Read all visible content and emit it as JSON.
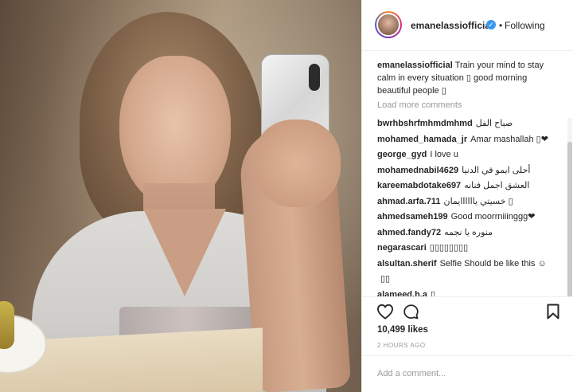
{
  "post": {
    "username": "emanelassiofficial",
    "follow_label": "Following",
    "caption_user": "emanelassiofficial",
    "caption_text": "Train your mind to stay calm in every situation ▯ good morning beautiful people ▯",
    "load_more": "Load more comments",
    "likes": "10,499 likes",
    "time_ago": "2 HOURS AGO",
    "comment_placeholder": "Add a comment..."
  },
  "comments": [
    {
      "user": "bwrhbshrfmhmdmhmd",
      "text": "صباح الفل"
    },
    {
      "user": "mohamed_hamada_jr",
      "text": "Amar mashallah ▯❤"
    },
    {
      "user": "george_gyd",
      "text": "I love u"
    },
    {
      "user": "mohamednabil4629",
      "text": "أحلى ايمو في الدنيا"
    },
    {
      "user": "kareemabdotake697",
      "text": "العشق اجمل فنانه"
    },
    {
      "user": "ahmad.arfa.711",
      "text": "خسيتي ياااااايمان ▯"
    },
    {
      "user": "ahmedsameh199",
      "text": "Good moorrniiinggg❤"
    },
    {
      "user": "ahmed.fandy72",
      "text": "منوره يا نجمه"
    },
    {
      "user": "negarascari",
      "text": "▯▯▯▯▯▯▯▯"
    },
    {
      "user": "alsultan.sherif",
      "text": "Selfie Should be like this ☺"
    },
    {
      "user": "",
      "text": "▯▯"
    },
    {
      "user": "alameed.h.a",
      "text": "▯"
    }
  ],
  "icons": {
    "verified": "verified-badge-icon",
    "like": "heart-icon",
    "comment": "comment-bubble-icon",
    "save": "bookmark-icon"
  },
  "colors": {
    "verified": "#3897f0",
    "text": "#262626",
    "muted": "#999999",
    "border": "#efefef"
  }
}
